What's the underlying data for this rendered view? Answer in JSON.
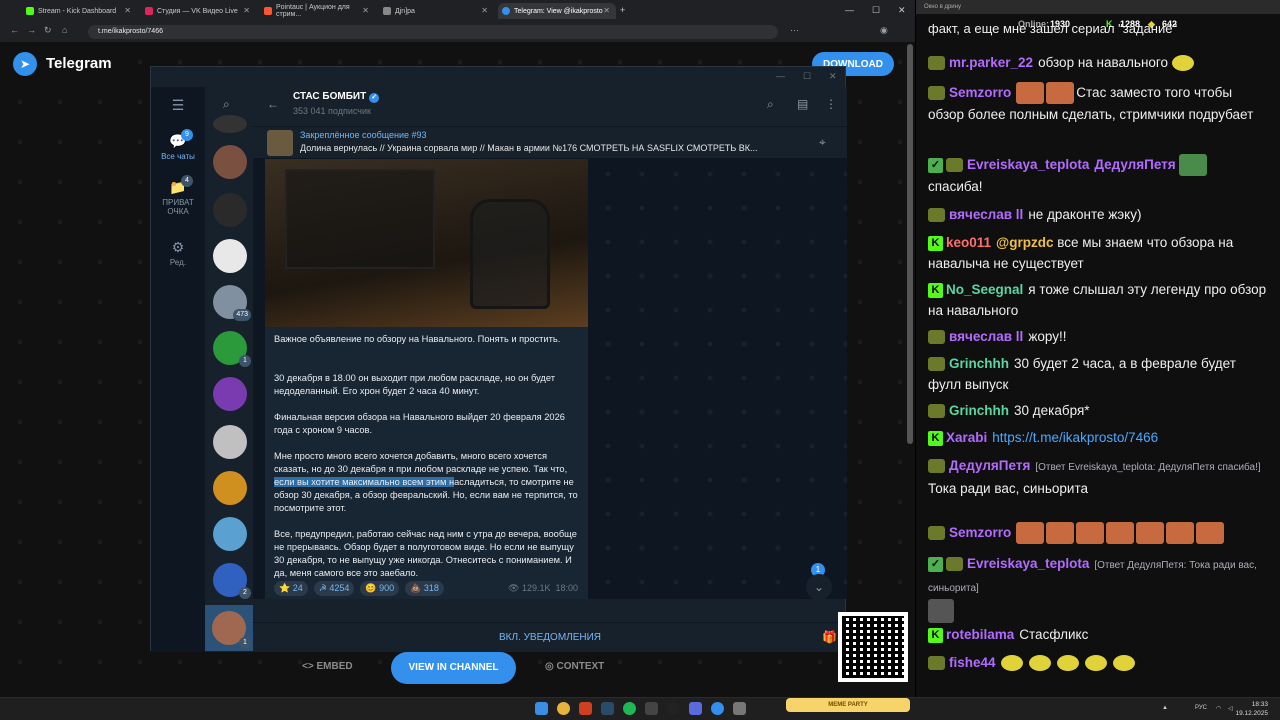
{
  "browser": {
    "tabs": [
      {
        "label": "Stream - Kick Dashboard",
        "color": "#53fc18"
      },
      {
        "label": "Студия — VK Видео Live",
        "color": "#e0245e"
      },
      {
        "label": "Pointauc | Аукцион для стрим...",
        "color": "#ff5533"
      },
      {
        "label": "Дjn]pa",
        "color": "#888888"
      },
      {
        "label": "Telegram: View @ikakprosto",
        "color": "#3390ec"
      }
    ],
    "url": "t.me/ikakprosto/7466"
  },
  "telegram": {
    "brand": "Telegram",
    "download": "DOWNLOAD",
    "folders": [
      {
        "label": "Все чаты",
        "badge": "9"
      },
      {
        "label": "ПРИВАТ ОЧКА",
        "badge": "4"
      },
      {
        "label": "Ред.",
        "badge": ""
      }
    ],
    "chat_badges": [
      "473",
      "1",
      "2",
      "1"
    ],
    "channel_name": "СТАС БОМБИТ",
    "subscribers": "353 041 подписчик",
    "pinned_title": "Закреплённое сообщение #93",
    "pinned_text": "Долина вернулась // Украина сорвала мир // Макан в армии №176  СМОТРЕТЬ НА SASFLIX  СМОТРЕТЬ ВК...",
    "post": {
      "p1": "Важное объявление по обзору на Навального. Понять и простить.",
      "p2": "30 декабря в 18.00 он выходит при любом раскладе, но он будет недоделанный. Его хрон будет 2 часа 40 минут.",
      "p3": "Финальная версия обзора на Навального выйдет 20 февраля 2026 года с хроном 9 часов.",
      "p4a": "Мне просто много всего хочется добавить, много всего хочется сказать, но до 30 декабря я при любом раскладе не успею. Так что, ",
      "p4hl": "если вы хотите максимально всем этим н",
      "p4b": "асладиться, то смотрите не обзор 30 декабря, а обзор февральский. Но, если вам не терпится, то посмотрите этот.",
      "p5": "Все, предупредил, работаю сейчас над ним с утра до вечера, вообще не прерываясь. Обзор будет в полуготовом виде. Но если не выпущу 30 декабря, то не выпущу уже никогда. Отнеситесь с пониманием. И да, меня самого все это заебало.",
      "reactions": [
        {
          "icon": "⭐",
          "count": "24"
        },
        {
          "icon": "☭",
          "count": "4254"
        },
        {
          "icon": "😊",
          "count": "900"
        },
        {
          "icon": "💩",
          "count": "318"
        }
      ],
      "views": "129.1K",
      "time": "18:00"
    },
    "scroll_badge": "1",
    "notify": "ВКЛ. УВЕДОМЛЕНИЯ",
    "embed": "EMBED",
    "view_in_channel": "VIEW IN CHANNEL",
    "context": "CONTEXT"
  },
  "chat": {
    "window_title": "Окно в дрину",
    "online_label": "Online:",
    "online": "1930",
    "k_count": "1288",
    "lemon_count": "642",
    "top_cut": "факт, а еще мне зашел сериал \"задание\"",
    "messages": [
      {
        "user": "mr.parker_22",
        "color": "#b36bff",
        "text": "обзор на навального"
      },
      {
        "user": "Semzorro",
        "color": "#b36bff",
        "text": "Стас заместо того чтобы обзор более полным сделать, стримчики подрубает"
      },
      {
        "user": "Evreiskaya_teplota",
        "color": "#b36bff",
        "text": "ДедуляПетя",
        "text2": "спасиба!"
      },
      {
        "user": "вячеслав ll",
        "color": "#b36bff",
        "text": "не драконте жэку)"
      },
      {
        "user": "keo011",
        "color": "#ff6f6f",
        "text": "@grpzdc",
        "text2": "все мы знаем что обзора на навалыча не существует"
      },
      {
        "user": "No_Seegnal",
        "color": "#5ad6a0",
        "text": "я тоже слышал эту легенду про обзор на навального"
      },
      {
        "user": "вячеслав ll",
        "color": "#b36bff",
        "text": "жору!!"
      },
      {
        "user": "Grinchhh",
        "color": "#5ad6a0",
        "text": "30 будет 2 часа, а в феврале будет фулл выпуск"
      },
      {
        "user": "Grinchhh",
        "color": "#5ad6a0",
        "text": "30 декабря*"
      },
      {
        "user": "Xarabi",
        "color": "#b36bff",
        "text": "https://t.me/ikakprosto/7466"
      },
      {
        "user": "ДедуляПетя",
        "color": "#b36bff",
        "reply": "[Ответ Evreiskaya_teplota: ДедуляПетя спасиба!]",
        "text": "Тока ради вас, синьорита"
      },
      {
        "user": "Semzorro",
        "color": "#b36bff",
        "text": ""
      },
      {
        "user": "Evreiskaya_teplota",
        "color": "#b36bff",
        "reply": "[Ответ ДедуляПетя: Тока ради вас, синьорита]",
        "text": ""
      },
      {
        "user": "rotebilama",
        "color": "#b36bff",
        "text": "Стасфликс"
      },
      {
        "user": "fishe44",
        "color": "#b36bff",
        "text": ""
      }
    ]
  },
  "taskbar": {
    "meme": "MEME PARTY",
    "lang": "РУС",
    "time": "18:33",
    "date": "19.12.2025"
  }
}
